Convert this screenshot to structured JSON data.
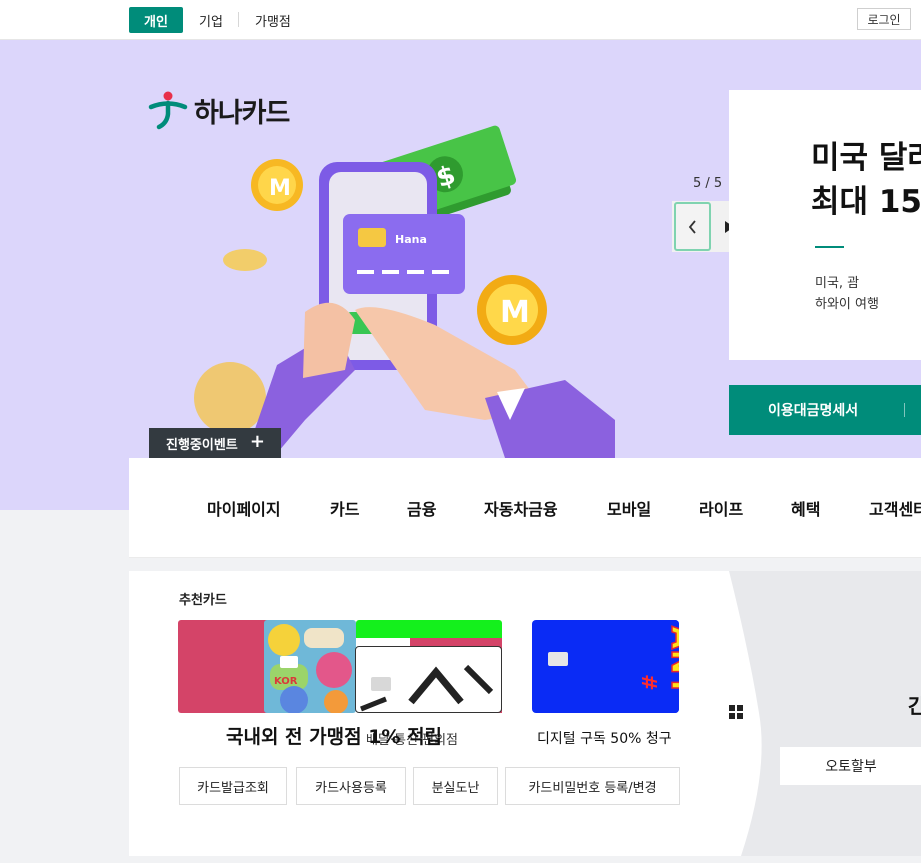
{
  "topbar": {
    "segments": [
      "개인",
      "기업",
      "가맹점"
    ],
    "login_label": "로그인"
  },
  "brand": {
    "logo_text": "하나카드",
    "card_brand": "Hana"
  },
  "hero": {
    "event_label": "진행중이벤트",
    "pager": {
      "current": 5,
      "total": 5,
      "text": "5 / 5"
    },
    "promo_title_line1": "미국 달러",
    "promo_title_line2": "최대 15",
    "promo_sub_line1": "미국, 괌",
    "promo_sub_line2": "하와이 여행",
    "statement_label": "이용대금명세서"
  },
  "gnb": {
    "items": [
      "마이페이지",
      "카드",
      "금융",
      "자동차금융",
      "모바일",
      "라이프",
      "혜택",
      "고객센터"
    ]
  },
  "recommend": {
    "title": "추천카드",
    "caption_main": "국내외 전 가맹점 1% 적립",
    "caption_overlap": "배달·통신·편의점",
    "caption_blue": "디지털 구독 50% 청구"
  },
  "quick": {
    "buttons": [
      "카드발급조회",
      "카드사용등록",
      "분실도난",
      "카드비밀번호 등록/변경"
    ]
  },
  "right_panel": {
    "peek_text": "간",
    "auto_label": "오토할부"
  },
  "colors": {
    "brand_green": "#008c7a",
    "hero_bg": "#dcd6fb",
    "card_pink": "#d44468",
    "card_blue": "#0a2bf5",
    "card_lime": "#14f01c"
  }
}
